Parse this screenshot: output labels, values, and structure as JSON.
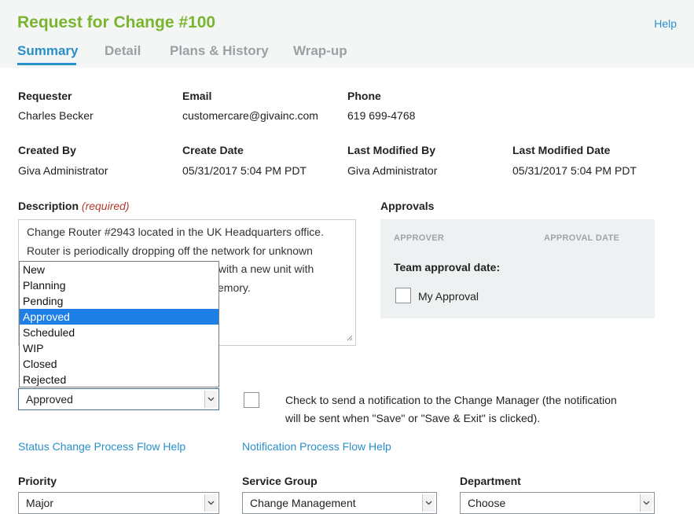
{
  "header": {
    "title": "Request for Change #100",
    "help": "Help",
    "tabs": [
      "Summary",
      "Detail",
      "Plans & History",
      "Wrap-up"
    ]
  },
  "info": {
    "requester_label": "Requester",
    "requester": "Charles Becker",
    "email_label": "Email",
    "email": "customercare@givainc.com",
    "phone_label": "Phone",
    "phone": "619 699-4768",
    "created_by_label": "Created By",
    "created_by": "Giva Administrator",
    "create_date_label": "Create Date",
    "create_date": "05/31/2017 5:04 PM PDT",
    "last_modified_by_label": "Last Modified By",
    "last_modified_by": "Giva Administrator",
    "last_modified_date_label": "Last Modified Date",
    "last_modified_date": "05/31/2017 5:04 PM PDT"
  },
  "description": {
    "label": "Description",
    "required": "(required)",
    "lines": [
      "Change Router #2943 located in the UK Headquarters office.",
      "Router is periodically dropping off the network for unknown",
      "it with a new unit with",
      "emory."
    ]
  },
  "approvals": {
    "label": "Approvals",
    "col_approver": "APPROVER",
    "col_date": "APPROVAL DATE",
    "team_date": "Team approval date:",
    "my_approval": "My Approval"
  },
  "status": {
    "options": [
      "New",
      "Planning",
      "Pending",
      "Approved",
      "Scheduled",
      "WIP",
      "Closed",
      "Rejected"
    ],
    "selected": "Approved"
  },
  "notification": {
    "text_line1": "Check to send a notification to the Change Manager (the notification",
    "text_line2": "will be sent when \"Save\" or \"Save & Exit\" is clicked)."
  },
  "links": {
    "status_help": "Status Change Process Flow Help",
    "notification_help": "Notification Process Flow Help"
  },
  "fields": {
    "priority_label": "Priority",
    "priority": "Major",
    "service_group_label": "Service Group",
    "service_group": "Change Management",
    "department_label": "Department",
    "department": "Choose"
  },
  "icons": {
    "select_arrow": "chevron-down-icon",
    "resize": "resize-grip-icon"
  },
  "colors": {
    "title": "#7ab52f",
    "accent": "#2a8fc9",
    "required": "#b33a2e",
    "selected_option": "#1e7fe6"
  }
}
